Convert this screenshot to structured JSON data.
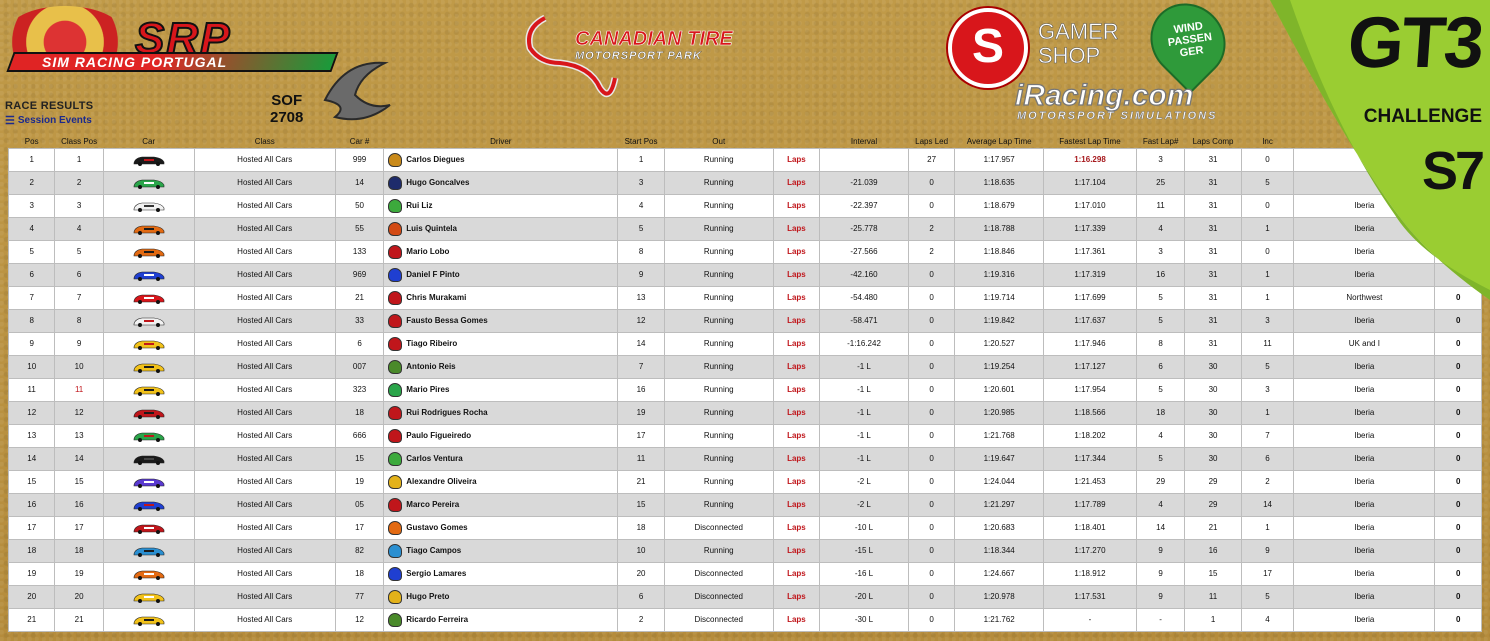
{
  "header": {
    "srp_wordmark": "SRP",
    "srp_tagline": "SIM RACING PORTUGAL",
    "race_results_label": "RACE RESULTS",
    "session_events_label": "Session Events",
    "sof_label": "SOF",
    "sof_value": "2708",
    "track_title": "CANADIAN TIRE",
    "track_subtitle": "MOTORSPORT PARK",
    "sponsor_gamer": "GAMER",
    "sponsor_shop": "SHOP",
    "sponsor_wind": "WIND PASSEN GER",
    "iracing_main": "iRacing.com",
    "iracing_sub": "MOTORSPORT SIMULATIONS",
    "series_title": "GT3",
    "series_challenge": "CHALLENGE",
    "series_season": "S7"
  },
  "colors": {
    "background": "#b8913f",
    "laps_red": "#c0161b",
    "row_alt": "#d9d9d9"
  },
  "table": {
    "columns": [
      "Pos",
      "Class Pos",
      "Car",
      "Class",
      "Car #",
      "Driver",
      "Start Pos",
      "Out",
      "",
      "Interval",
      "Laps Led",
      "Average Lap Time",
      "Fastest Lap Time",
      "Fast Lap#",
      "Laps Comp",
      "Inc",
      "",
      ""
    ],
    "rows": [
      {
        "pos": "1",
        "class_pos": "1",
        "car_color": "#1a1a1a",
        "car_accent": "#c0161b",
        "class": "Hosted All Cars",
        "car_no": "999",
        "helmet": "#c98a1a",
        "driver": "Carlos Diegues",
        "start": "1",
        "out": "Running",
        "laps": "Laps",
        "interval": "",
        "led": "27",
        "avg": "1:17.957",
        "fast": "1:16.298",
        "fast_lap": "3",
        "comp": "31",
        "inc": "0",
        "club": "",
        "pts": ""
      },
      {
        "pos": "2",
        "class_pos": "2",
        "car_color": "#2aa54a",
        "car_accent": "#ffffff",
        "class": "Hosted All Cars",
        "car_no": "14",
        "helmet": "#1e2b6b",
        "driver": "Hugo Goncalves",
        "start": "3",
        "out": "Running",
        "laps": "Laps",
        "interval": "-21.039",
        "led": "0",
        "avg": "1:18.635",
        "fast": "1:17.104",
        "fast_lap": "25",
        "comp": "31",
        "inc": "5",
        "club": "",
        "pts": ""
      },
      {
        "pos": "3",
        "class_pos": "3",
        "car_color": "#f2f2f2",
        "car_accent": "#333333",
        "class": "Hosted All Cars",
        "car_no": "50",
        "helmet": "#3caa3c",
        "driver": "Rui Liz",
        "start": "4",
        "out": "Running",
        "laps": "Laps",
        "interval": "-22.397",
        "led": "0",
        "avg": "1:18.679",
        "fast": "1:17.010",
        "fast_lap": "11",
        "comp": "31",
        "inc": "0",
        "club": "Iberia",
        "pts": ""
      },
      {
        "pos": "4",
        "class_pos": "4",
        "car_color": "#e36a12",
        "car_accent": "#1a1a1a",
        "class": "Hosted All Cars",
        "car_no": "55",
        "helmet": "#d34a14",
        "driver": "Luis Quintela",
        "start": "5",
        "out": "Running",
        "laps": "Laps",
        "interval": "-25.778",
        "led": "2",
        "avg": "1:18.788",
        "fast": "1:17.339",
        "fast_lap": "4",
        "comp": "31",
        "inc": "1",
        "club": "Iberia",
        "pts": ""
      },
      {
        "pos": "5",
        "class_pos": "5",
        "car_color": "#e36a12",
        "car_accent": "#1a1a1a",
        "class": "Hosted All Cars",
        "car_no": "133",
        "helmet": "#c0161b",
        "driver": "Mario Lobo",
        "start": "8",
        "out": "Running",
        "laps": "Laps",
        "interval": "-27.566",
        "led": "2",
        "avg": "1:18.846",
        "fast": "1:17.361",
        "fast_lap": "3",
        "comp": "31",
        "inc": "0",
        "club": "Iberia",
        "pts": ""
      },
      {
        "pos": "6",
        "class_pos": "6",
        "car_color": "#1f3fd1",
        "car_accent": "#ffffff",
        "class": "Hosted All Cars",
        "car_no": "969",
        "helmet": "#1f3fd1",
        "driver": "Daniel F Pinto",
        "start": "9",
        "out": "Running",
        "laps": "Laps",
        "interval": "-42.160",
        "led": "0",
        "avg": "1:19.316",
        "fast": "1:17.319",
        "fast_lap": "16",
        "comp": "31",
        "inc": "1",
        "club": "Iberia",
        "pts": ""
      },
      {
        "pos": "7",
        "class_pos": "7",
        "car_color": "#d8161b",
        "car_accent": "#ffffff",
        "class": "Hosted All Cars",
        "car_no": "21",
        "helmet": "#c0161b",
        "driver": "Chris Murakami",
        "start": "13",
        "out": "Running",
        "laps": "Laps",
        "interval": "-54.480",
        "led": "0",
        "avg": "1:19.714",
        "fast": "1:17.699",
        "fast_lap": "5",
        "comp": "31",
        "inc": "1",
        "club": "Northwest",
        "pts": "0"
      },
      {
        "pos": "8",
        "class_pos": "8",
        "car_color": "#f2f2f2",
        "car_accent": "#c0161b",
        "class": "Hosted All Cars",
        "car_no": "33",
        "helmet": "#c0161b",
        "driver": "Fausto Bessa Gomes",
        "start": "12",
        "out": "Running",
        "laps": "Laps",
        "interval": "-58.471",
        "led": "0",
        "avg": "1:19.842",
        "fast": "1:17.637",
        "fast_lap": "5",
        "comp": "31",
        "inc": "3",
        "club": "Iberia",
        "pts": "0"
      },
      {
        "pos": "9",
        "class_pos": "9",
        "car_color": "#f2c21a",
        "car_accent": "#c0161b",
        "class": "Hosted All Cars",
        "car_no": "6",
        "helmet": "#c0161b",
        "driver": "Tiago Ribeiro",
        "start": "14",
        "out": "Running",
        "laps": "Laps",
        "interval": "-1:16.242",
        "led": "0",
        "avg": "1:20.527",
        "fast": "1:17.946",
        "fast_lap": "8",
        "comp": "31",
        "inc": "11",
        "club": "UK and I",
        "pts": "0"
      },
      {
        "pos": "10",
        "class_pos": "10",
        "car_color": "#f2c21a",
        "car_accent": "#1a1a1a",
        "class": "Hosted All Cars",
        "car_no": "007",
        "helmet": "#4a8a2a",
        "driver": "Antonio Reis",
        "start": "7",
        "out": "Running",
        "laps": "Laps",
        "interval": "-1 L",
        "led": "0",
        "avg": "1:19.254",
        "fast": "1:17.127",
        "fast_lap": "6",
        "comp": "30",
        "inc": "5",
        "club": "Iberia",
        "pts": "0"
      },
      {
        "pos": "11",
        "class_pos": "11",
        "car_color": "#f2c21a",
        "car_accent": "#1a1a1a",
        "class": "Hosted All Cars",
        "car_no": "323",
        "helmet": "#2aa54a",
        "driver": "Mario Pires",
        "start": "16",
        "out": "Running",
        "laps": "Laps",
        "interval": "-1 L",
        "led": "0",
        "avg": "1:20.601",
        "fast": "1:17.954",
        "fast_lap": "5",
        "comp": "30",
        "inc": "3",
        "club": "Iberia",
        "pts": "0"
      },
      {
        "pos": "12",
        "class_pos": "12",
        "car_color": "#c0161b",
        "car_accent": "#1a1a1a",
        "class": "Hosted All Cars",
        "car_no": "18",
        "helmet": "#c0161b",
        "driver": "Rui Rodrigues Rocha",
        "start": "19",
        "out": "Running",
        "laps": "Laps",
        "interval": "-1 L",
        "led": "0",
        "avg": "1:20.985",
        "fast": "1:18.566",
        "fast_lap": "18",
        "comp": "30",
        "inc": "1",
        "club": "Iberia",
        "pts": "0"
      },
      {
        "pos": "13",
        "class_pos": "13",
        "car_color": "#2aa54a",
        "car_accent": "#c0161b",
        "class": "Hosted All Cars",
        "car_no": "666",
        "helmet": "#c0161b",
        "driver": "Paulo Figueiredo",
        "start": "17",
        "out": "Running",
        "laps": "Laps",
        "interval": "-1 L",
        "led": "0",
        "avg": "1:21.768",
        "fast": "1:18.202",
        "fast_lap": "4",
        "comp": "30",
        "inc": "7",
        "club": "Iberia",
        "pts": "0"
      },
      {
        "pos": "14",
        "class_pos": "14",
        "car_color": "#1a1a1a",
        "car_accent": "#444444",
        "class": "Hosted All Cars",
        "car_no": "15",
        "helmet": "#3caa3c",
        "driver": "Carlos Ventura",
        "start": "11",
        "out": "Running",
        "laps": "Laps",
        "interval": "-1 L",
        "led": "0",
        "avg": "1:19.647",
        "fast": "1:17.344",
        "fast_lap": "5",
        "comp": "30",
        "inc": "6",
        "club": "Iberia",
        "pts": "0"
      },
      {
        "pos": "15",
        "class_pos": "15",
        "car_color": "#5a3ad1",
        "car_accent": "#ffffff",
        "class": "Hosted All Cars",
        "car_no": "19",
        "helmet": "#e3b21a",
        "driver": "Alexandre Oliveira",
        "start": "21",
        "out": "Running",
        "laps": "Laps",
        "interval": "-2 L",
        "led": "0",
        "avg": "1:24.044",
        "fast": "1:21.453",
        "fast_lap": "29",
        "comp": "29",
        "inc": "2",
        "club": "Iberia",
        "pts": "0"
      },
      {
        "pos": "16",
        "class_pos": "16",
        "car_color": "#1f3fd1",
        "car_accent": "#c0161b",
        "class": "Hosted All Cars",
        "car_no": "05",
        "helmet": "#c0161b",
        "driver": "Marco Pereira",
        "start": "15",
        "out": "Running",
        "laps": "Laps",
        "interval": "-2 L",
        "led": "0",
        "avg": "1:21.297",
        "fast": "1:17.789",
        "fast_lap": "4",
        "comp": "29",
        "inc": "14",
        "club": "Iberia",
        "pts": "0"
      },
      {
        "pos": "17",
        "class_pos": "17",
        "car_color": "#c0161b",
        "car_accent": "#ffffff",
        "class": "Hosted All Cars",
        "car_no": "17",
        "helmet": "#e36a12",
        "driver": "Gustavo Gomes",
        "start": "18",
        "out": "Disconnected",
        "laps": "Laps",
        "interval": "-10 L",
        "led": "0",
        "avg": "1:20.683",
        "fast": "1:18.401",
        "fast_lap": "14",
        "comp": "21",
        "inc": "1",
        "club": "Iberia",
        "pts": "0"
      },
      {
        "pos": "18",
        "class_pos": "18",
        "car_color": "#2a8fd1",
        "car_accent": "#1a1a1a",
        "class": "Hosted All Cars",
        "car_no": "82",
        "helmet": "#2a8fd1",
        "driver": "Tiago Campos",
        "start": "10",
        "out": "Running",
        "laps": "Laps",
        "interval": "-15 L",
        "led": "0",
        "avg": "1:18.344",
        "fast": "1:17.270",
        "fast_lap": "9",
        "comp": "16",
        "inc": "9",
        "club": "Iberia",
        "pts": "0"
      },
      {
        "pos": "19",
        "class_pos": "19",
        "car_color": "#e36a12",
        "car_accent": "#ffffff",
        "class": "Hosted All Cars",
        "car_no": "18",
        "helmet": "#1f3fd1",
        "driver": "Sergio Lamares",
        "start": "20",
        "out": "Disconnected",
        "laps": "Laps",
        "interval": "-16 L",
        "led": "0",
        "avg": "1:24.667",
        "fast": "1:18.912",
        "fast_lap": "9",
        "comp": "15",
        "inc": "17",
        "club": "Iberia",
        "pts": "0"
      },
      {
        "pos": "20",
        "class_pos": "20",
        "car_color": "#f2c21a",
        "car_accent": "#ffffff",
        "class": "Hosted All Cars",
        "car_no": "77",
        "helmet": "#e3b21a",
        "driver": "Hugo Preto",
        "start": "6",
        "out": "Disconnected",
        "laps": "Laps",
        "interval": "-20 L",
        "led": "0",
        "avg": "1:20.978",
        "fast": "1:17.531",
        "fast_lap": "9",
        "comp": "11",
        "inc": "5",
        "club": "Iberia",
        "pts": "0"
      },
      {
        "pos": "21",
        "class_pos": "21",
        "car_color": "#f2c21a",
        "car_accent": "#1a1a1a",
        "class": "Hosted All Cars",
        "car_no": "12",
        "helmet": "#4a8a2a",
        "driver": "Ricardo Ferreira",
        "start": "2",
        "out": "Disconnected",
        "laps": "Laps",
        "interval": "-30 L",
        "led": "0",
        "avg": "1:21.762",
        "fast": "-",
        "fast_lap": "-",
        "comp": "1",
        "inc": "4",
        "club": "Iberia",
        "pts": "0"
      }
    ]
  }
}
